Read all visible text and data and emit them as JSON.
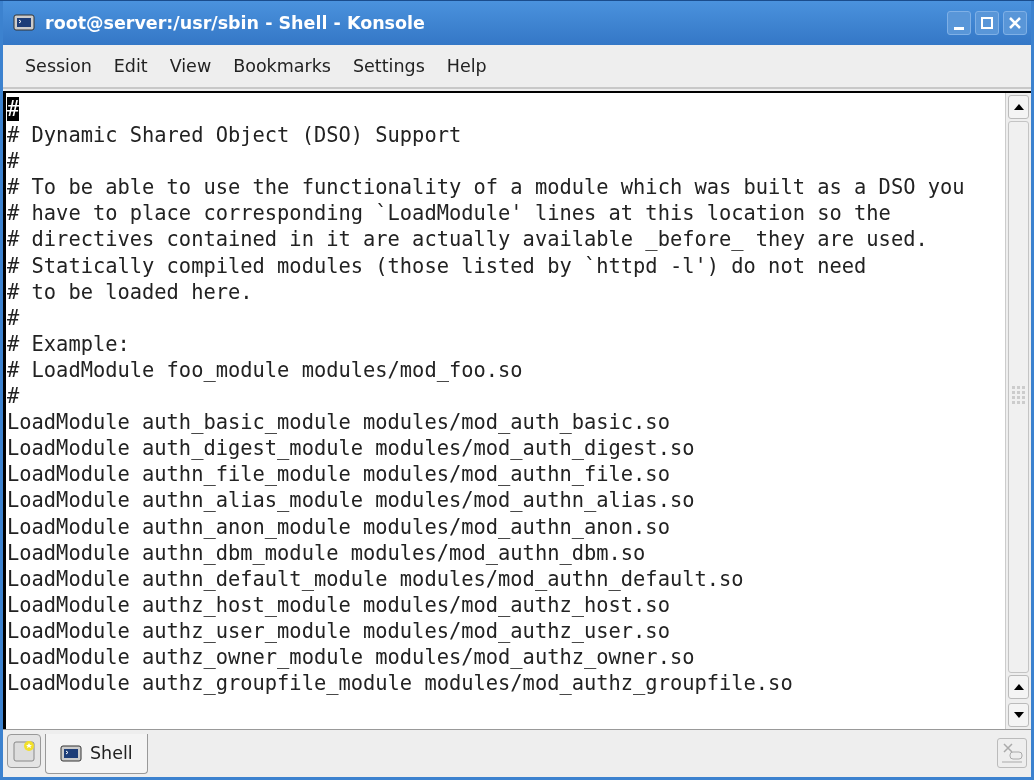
{
  "window": {
    "title": "root@server:/usr/sbin - Shell - Konsole"
  },
  "menu": [
    "Session",
    "Edit",
    "View",
    "Bookmarks",
    "Settings",
    "Help"
  ],
  "terminal": {
    "cursor_text": "#",
    "lines": [
      "# Dynamic Shared Object (DSO) Support",
      "#",
      "# To be able to use the functionality of a module which was built as a DSO you",
      "# have to place corresponding `LoadModule' lines at this location so the",
      "# directives contained in it are actually available _before_ they are used.",
      "# Statically compiled modules (those listed by `httpd -l') do not need",
      "# to be loaded here.",
      "#",
      "# Example:",
      "# LoadModule foo_module modules/mod_foo.so",
      "#",
      "LoadModule auth_basic_module modules/mod_auth_basic.so",
      "LoadModule auth_digest_module modules/mod_auth_digest.so",
      "LoadModule authn_file_module modules/mod_authn_file.so",
      "LoadModule authn_alias_module modules/mod_authn_alias.so",
      "LoadModule authn_anon_module modules/mod_authn_anon.so",
      "LoadModule authn_dbm_module modules/mod_authn_dbm.so",
      "LoadModule authn_default_module modules/mod_authn_default.so",
      "LoadModule authz_host_module modules/mod_authz_host.so",
      "LoadModule authz_user_module modules/mod_authz_user.so",
      "LoadModule authz_owner_module modules/mod_authz_owner.so",
      "LoadModule authz_groupfile_module modules/mod_authz_groupfile.so"
    ]
  },
  "tabs": [
    {
      "label": "Shell",
      "selected": true
    }
  ]
}
